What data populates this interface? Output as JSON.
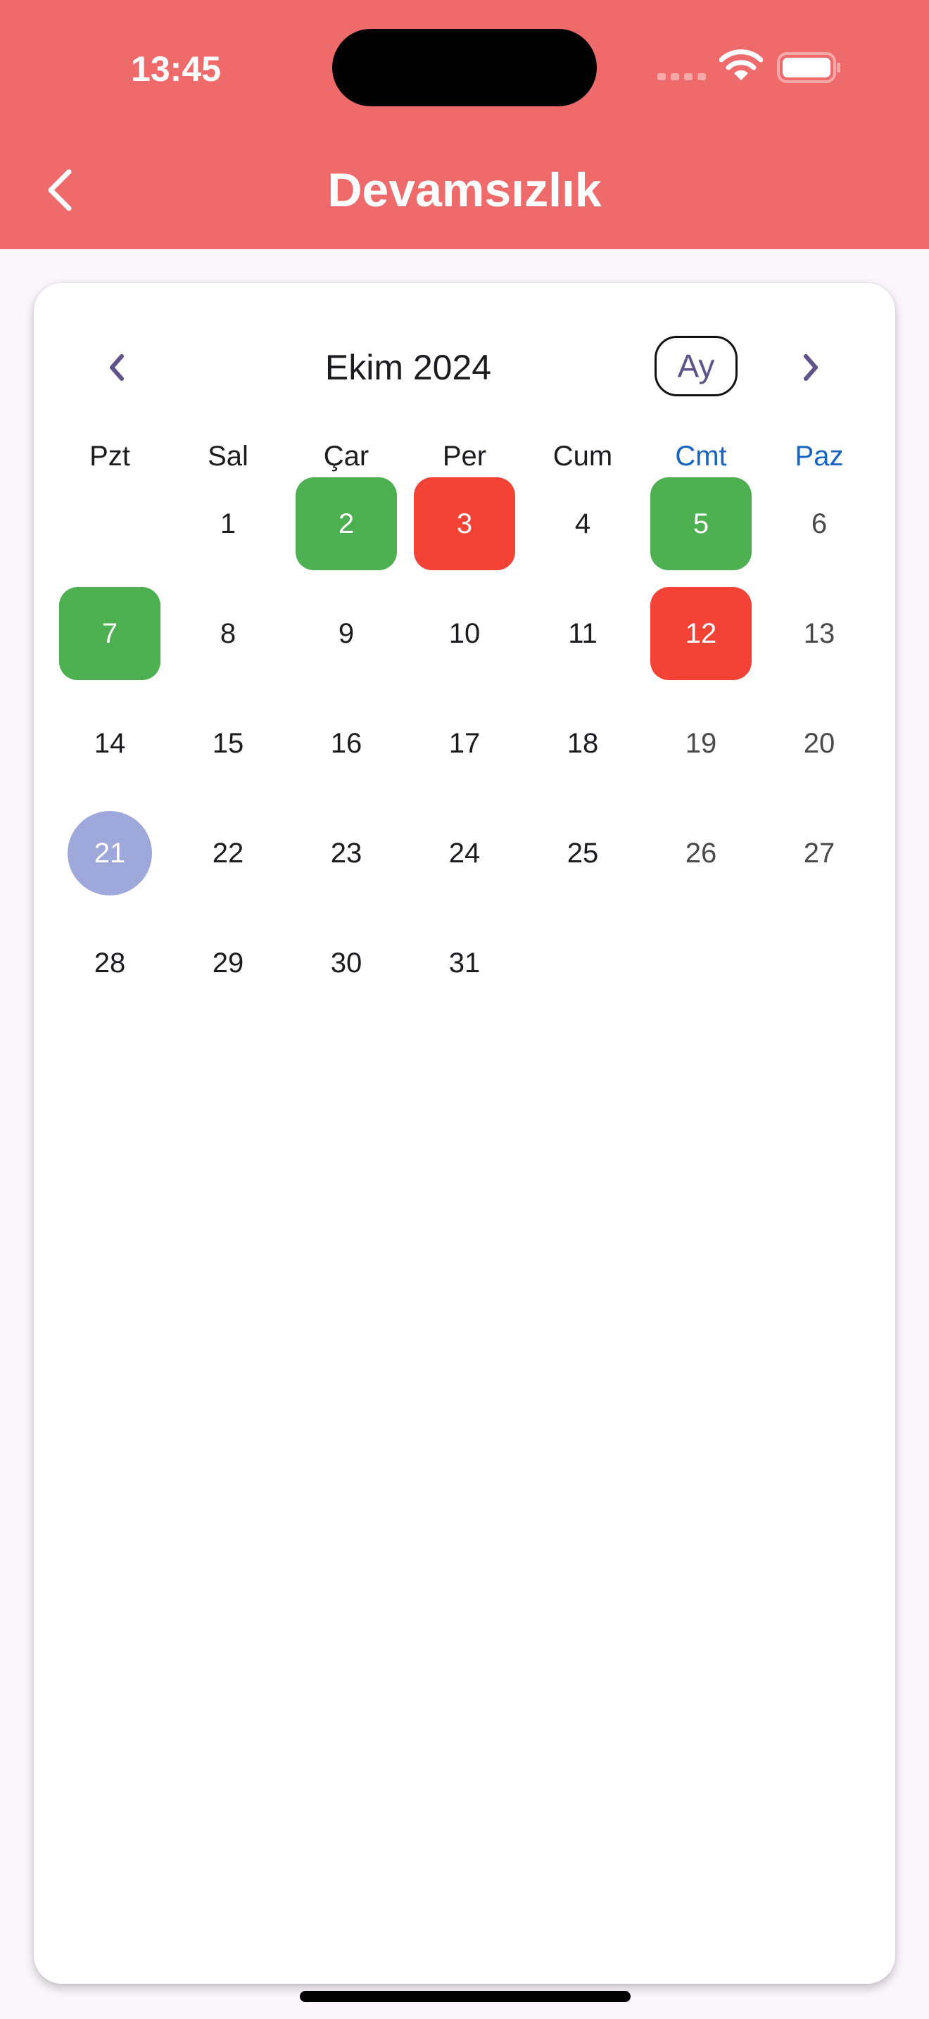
{
  "status_bar": {
    "time": "13:45"
  },
  "header": {
    "title": "Devamsızlık",
    "color": "#ef6b6b"
  },
  "calendar": {
    "month_title": "Ekim 2024",
    "view_toggle": "Ay",
    "weekdays": [
      "Pzt",
      "Sal",
      "Çar",
      "Per",
      "Cum",
      "Cmt",
      "Paz"
    ],
    "weeks": [
      [
        "",
        "1",
        "2",
        "3",
        "4",
        "5",
        "6"
      ],
      [
        "7",
        "8",
        "9",
        "10",
        "11",
        "12",
        "13"
      ],
      [
        "14",
        "15",
        "16",
        "17",
        "18",
        "19",
        "20"
      ],
      [
        "21",
        "22",
        "23",
        "24",
        "25",
        "26",
        "27"
      ],
      [
        "28",
        "29",
        "30",
        "31",
        "",
        "",
        ""
      ]
    ],
    "present_days": [
      "2",
      "5",
      "7"
    ],
    "absent_days": [
      "3",
      "12"
    ],
    "today": "21",
    "colors": {
      "present": "#4caf50",
      "absent": "#f44336",
      "today": "#9fa8da",
      "weekend_label": "#1565c0",
      "nav_arrow": "#5f5389"
    }
  }
}
